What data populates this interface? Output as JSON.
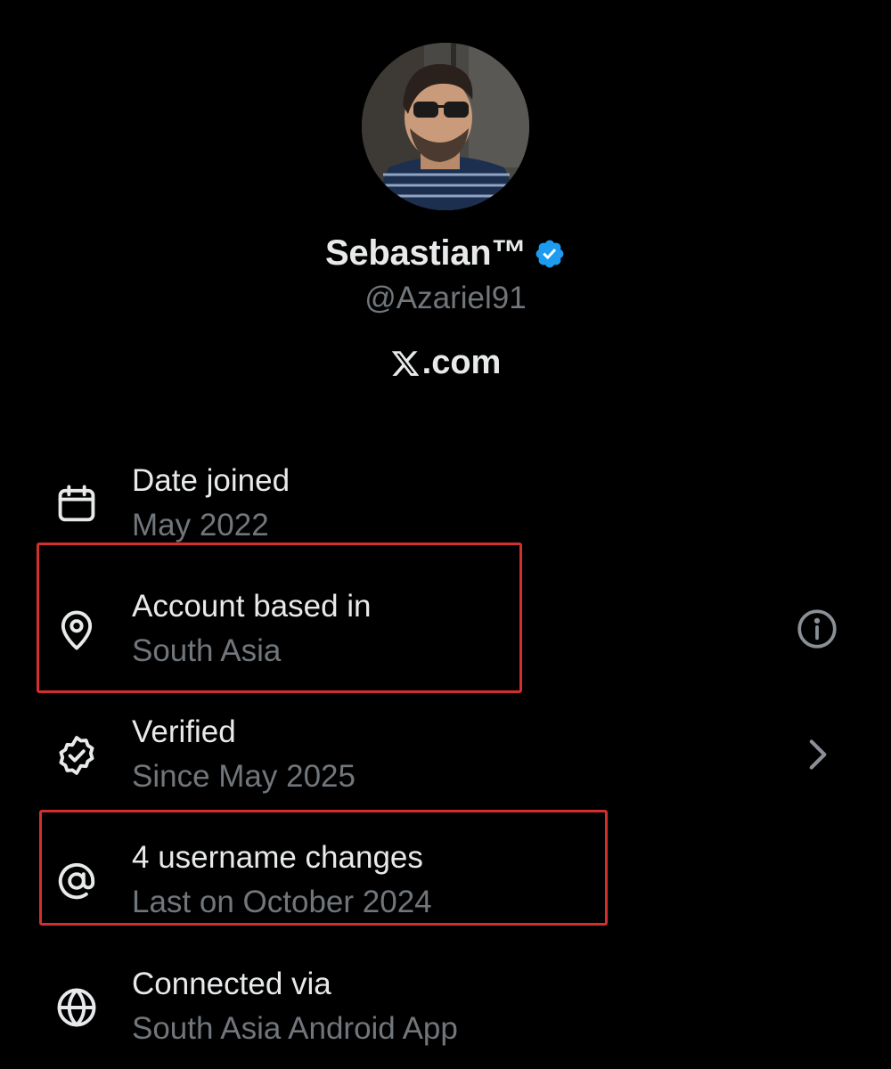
{
  "profile": {
    "display_name": "Sebastian™",
    "handle": "@Azariel91",
    "verified_icon": "verified-badge-icon",
    "site_label": ".com",
    "site_logo": "x-logo-icon"
  },
  "colors": {
    "background": "#000000",
    "primary_text": "#e7e9ea",
    "secondary_text": "#71767b",
    "verified_blue": "#1d9bf0",
    "highlight_border": "#d32f2f"
  },
  "rows": [
    {
      "icon": "calendar-icon",
      "title": "Date joined",
      "subtitle": "May 2022",
      "trailing": null
    },
    {
      "icon": "location-pin-icon",
      "title": "Account based in",
      "subtitle": "South Asia",
      "trailing": "info-icon",
      "highlighted": true
    },
    {
      "icon": "verified-outline-icon",
      "title": "Verified",
      "subtitle": "Since May 2025",
      "trailing": "chevron-right-icon"
    },
    {
      "icon": "at-sign-icon",
      "title": "4 username changes",
      "subtitle": "Last on October 2024",
      "trailing": null,
      "highlighted": true
    },
    {
      "icon": "globe-icon",
      "title": "Connected via",
      "subtitle": "South Asia Android App",
      "trailing": null
    }
  ]
}
